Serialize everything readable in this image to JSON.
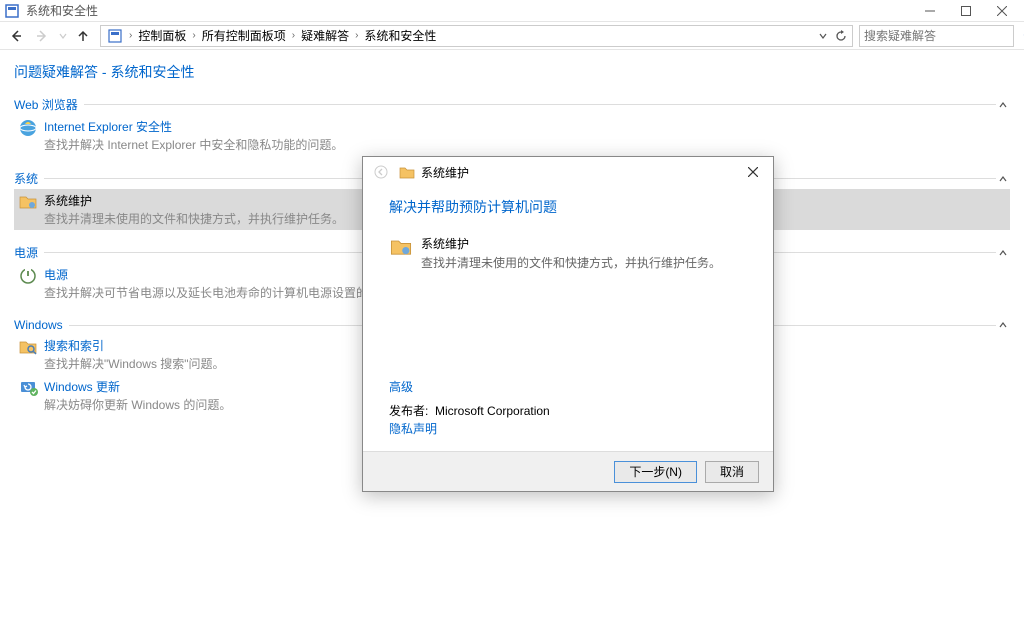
{
  "window": {
    "title": "系统和安全性",
    "min_tooltip": "最小化",
    "max_tooltip": "最大化",
    "close_tooltip": "关闭"
  },
  "nav": {
    "breadcrumb": [
      "控制面板",
      "所有控制面板项",
      "疑难解答",
      "系统和安全性"
    ],
    "search_placeholder": "搜索疑难解答"
  },
  "page": {
    "header": "问题疑难解答 - 系统和安全性"
  },
  "sections": [
    {
      "name": "Web 浏览器",
      "items": [
        {
          "title": "Internet Explorer 安全性",
          "desc": "查找并解决 Internet Explorer 中安全和隐私功能的问题。",
          "selected": false,
          "icon": "browser"
        }
      ]
    },
    {
      "name": "系统",
      "items": [
        {
          "title": "系统维护",
          "desc": "查找并清理未使用的文件和快捷方式，并执行维护任务。",
          "selected": true,
          "icon": "folder"
        }
      ]
    },
    {
      "name": "电源",
      "items": [
        {
          "title": "电源",
          "desc": "查找并解决可节省电源以及延长电池寿命的计算机电源设置的问题。",
          "selected": false,
          "icon": "power"
        }
      ]
    },
    {
      "name": "Windows",
      "items": [
        {
          "title": "搜索和索引",
          "desc": "查找并解决\"Windows 搜索\"问题。",
          "selected": false,
          "icon": "search"
        },
        {
          "title": "Windows 更新",
          "desc": "解决妨碍你更新 Windows 的问题。",
          "selected": false,
          "icon": "update"
        }
      ]
    }
  ],
  "dialog": {
    "title": "系统维护",
    "heading": "解决并帮助预防计算机问题",
    "item_title": "系统维护",
    "item_desc": "查找并清理未使用的文件和快捷方式，并执行维护任务。",
    "advanced": "高级",
    "publisher_label": "发布者:",
    "publisher_value": "Microsoft Corporation",
    "privacy": "隐私声明",
    "next": "下一步(N)",
    "cancel": "取消"
  }
}
